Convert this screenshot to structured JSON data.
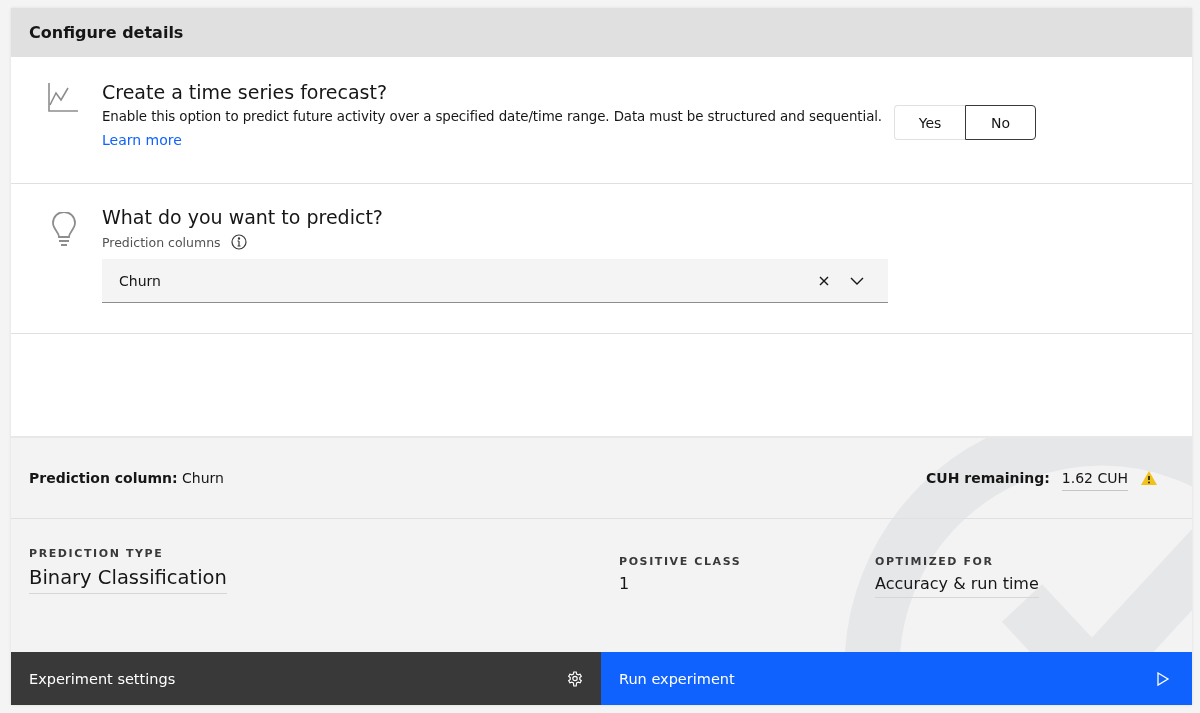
{
  "header": {
    "title": "Configure details"
  },
  "forecast": {
    "title": "Create a time series forecast?",
    "description": "Enable this option to predict future activity over a specified date/time range. Data must be structured and sequential.",
    "link": "Learn more",
    "options": [
      {
        "label": "Yes",
        "selected": false
      },
      {
        "label": "No",
        "selected": true
      }
    ]
  },
  "predict": {
    "title": "What do you want to predict?",
    "field_label": "Prediction columns",
    "value": "Churn"
  },
  "summary": {
    "prediction_column": "**Prediction column:** Churn",
    "cuh_label": "CUH remaining:",
    "cuh_value": "1.62 CUH",
    "cuh_warning": true,
    "details": [
      {
        "label": "PREDICTION TYPE",
        "value": "Binary Classification",
        "underlined": true,
        "kind": "headline"
      },
      {
        "label": "POSITIVE CLASS",
        "value": "1",
        "underlined": false,
        "kind": "plain"
      },
      {
        "label": "OPTIMIZED FOR",
        "value": "Accuracy & run time",
        "underlined": true,
        "kind": "plain"
      }
    ]
  },
  "actions": {
    "settings": "Experiment settings",
    "run": "Run experiment"
  }
}
